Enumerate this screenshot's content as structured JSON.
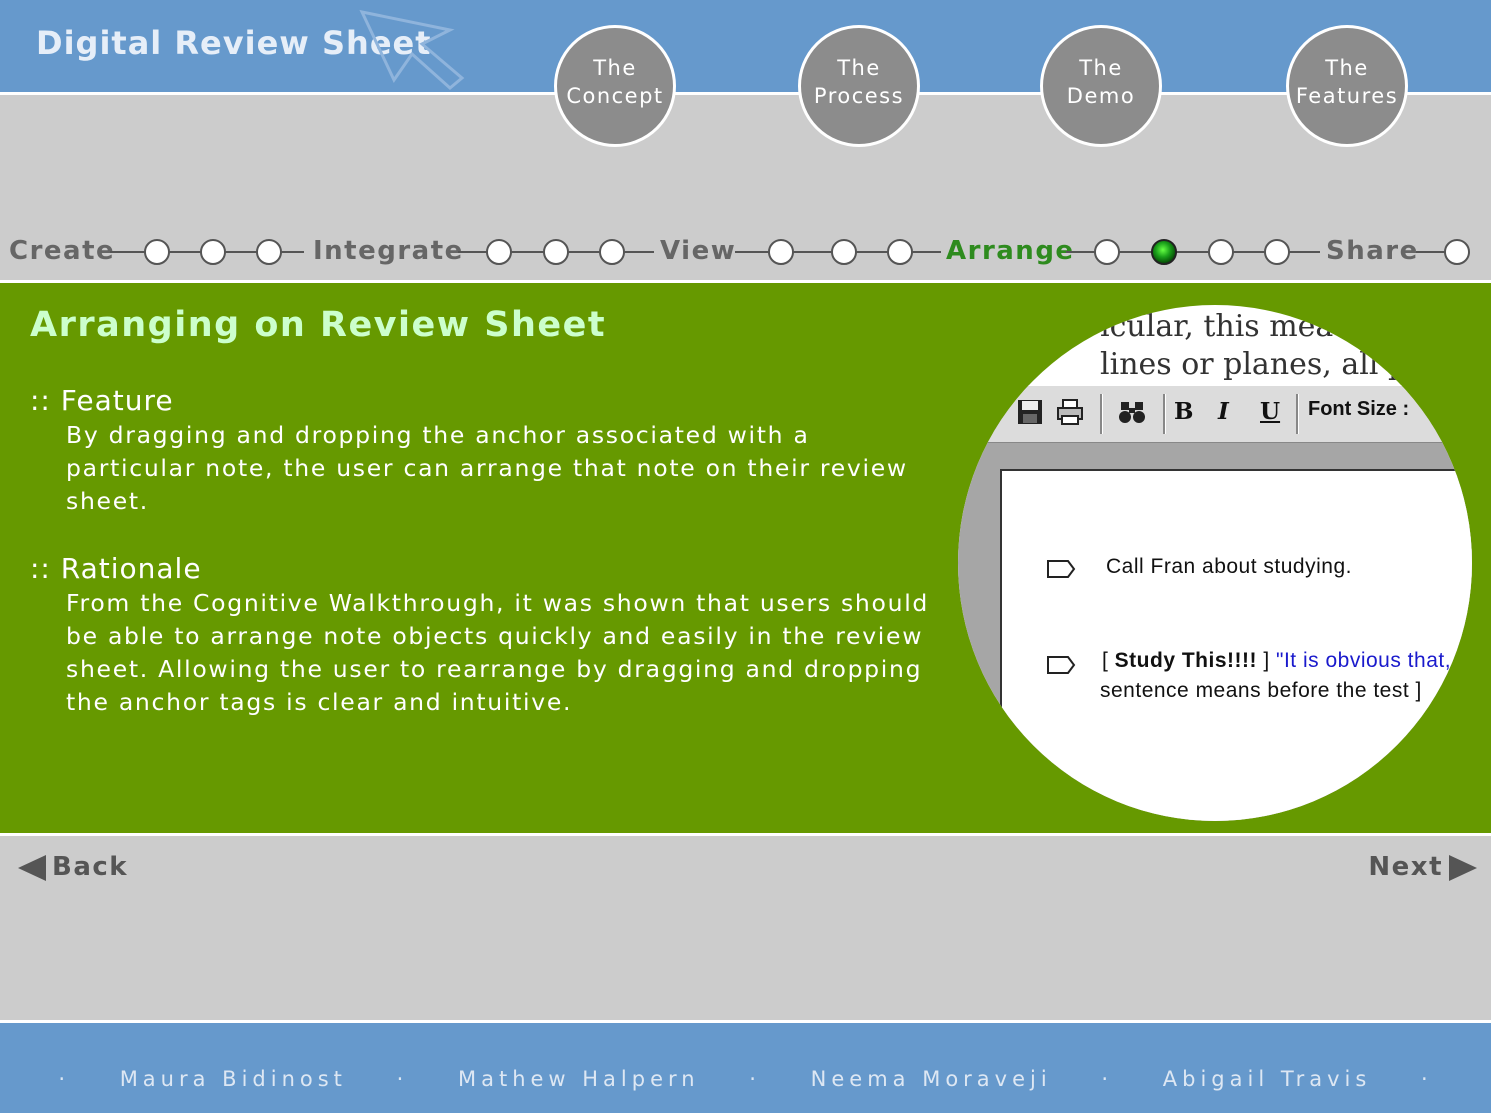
{
  "header": {
    "app_title": "Digital Review Sheet",
    "nav": [
      {
        "line1": "The",
        "line2": "Concept"
      },
      {
        "line1": "The",
        "line2": "Process"
      },
      {
        "line1": "The",
        "line2": "Demo"
      },
      {
        "line1": "The",
        "line2": "Features"
      }
    ]
  },
  "timeline": {
    "stages": [
      "Create",
      "Integrate",
      "View",
      "Arrange",
      "Share"
    ],
    "active_stage": "Arrange",
    "active_color": "#2e8b1e"
  },
  "content": {
    "title": "Arranging on Review Sheet",
    "feature_head": ":: Feature",
    "feature_body": "By dragging and dropping the anchor associated with a particular note, the user can arrange that note on their review sheet.",
    "rationale_head": ":: Rationale",
    "rationale_body": "From the Cognitive Walkthrough, it was shown that users should be able to arrange note objects quickly and easily in the review sheet.  Allowing the user to rearrange by dragging and dropping the anchor tags is clear and intuitive.",
    "background_color": "#669900"
  },
  "zoom_view": {
    "doc_line1": "icular, this mea",
    "doc_line2": "lines or planes, all pa",
    "toolbar": {
      "bold": "B",
      "italic": "I",
      "underline": "U",
      "font_size_label": "Font Size :"
    },
    "note1": "Call Fran about studying.",
    "note2_tag": "Study This!!!!",
    "note2_quote": "\"It is obvious that, ('",
    "note2_line2": "sentence means before the test ]"
  },
  "navigation": {
    "back": "Back",
    "next": "Next"
  },
  "footer": {
    "authors": [
      "Maura Bidinost",
      "Mathew Halpern",
      "Neema Moraveji",
      "Abigail Travis"
    ],
    "separator": "·"
  },
  "colors": {
    "header": "#6699cc",
    "body": "#cccccc",
    "content": "#669900"
  }
}
